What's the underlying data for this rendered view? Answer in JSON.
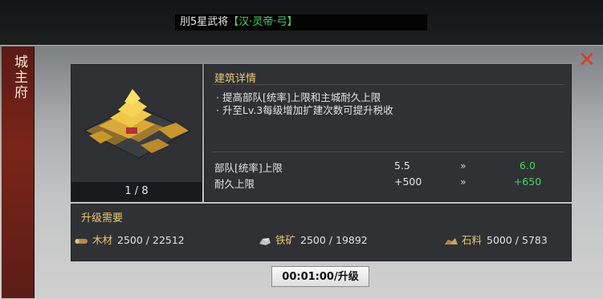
{
  "notice": {
    "prefix": "刖5星武将",
    "highlight": "【汉·灵帝·弓】"
  },
  "side_title": "城主府",
  "building": {
    "count": "1 / 8"
  },
  "details": {
    "title": "建筑详情",
    "lines": [
      "· 提高部队[统率]上限和主城耐久上限",
      "· 升至Lv.3每级增加扩建次数可提升税收"
    ],
    "stats": [
      {
        "label": "部队[统率]上限",
        "from": "5.5",
        "arrow": "»",
        "to": "6.0"
      },
      {
        "label": "耐久上限",
        "from": "+500",
        "arrow": "»",
        "to": "+650"
      }
    ]
  },
  "requirements": {
    "title": "升级需要",
    "resources": [
      {
        "icon": "wood-icon",
        "name": "木材",
        "value": "2500 / 22512"
      },
      {
        "icon": "iron-ore-icon",
        "name": "铁矿",
        "value": "2500 / 19892"
      },
      {
        "icon": "stone-icon",
        "name": "石料",
        "value": "5000 / 5783"
      }
    ]
  },
  "upgrade_button": "00:01:00/升级",
  "colors": {
    "accent_gold": "#e7c875",
    "positive_green": "#4fd166",
    "close_red": "#d73a2a"
  }
}
